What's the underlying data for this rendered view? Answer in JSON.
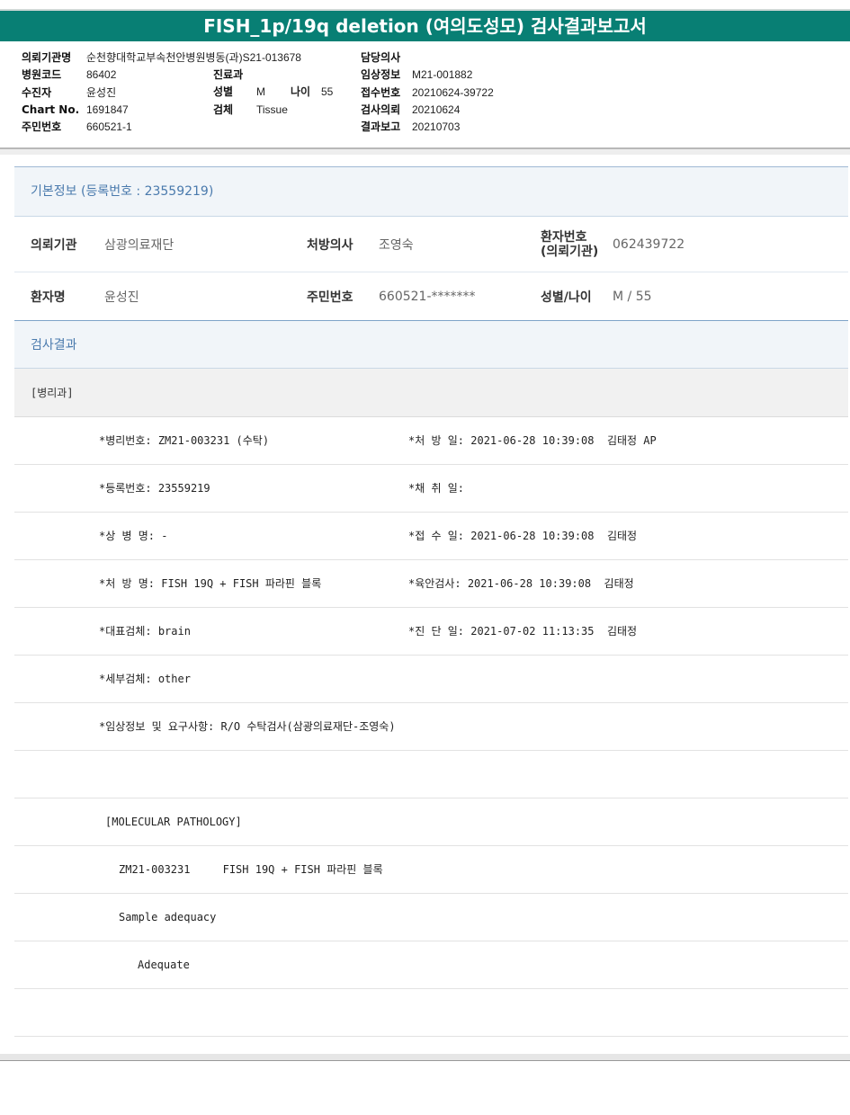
{
  "title": "FISH_1p/19q deletion (여의도성모) 검사결과보고서",
  "header": {
    "col1": [
      {
        "label": "의뢰기관명",
        "value": "순천향대학교부속천안병원병동(과)S21-013678"
      },
      {
        "label": "병원코드",
        "value": "86402"
      },
      {
        "label": "수진자",
        "value": "윤성진"
      },
      {
        "label": "Chart No.",
        "value": "1691847"
      },
      {
        "label": "주민번호",
        "value": "660521-1"
      }
    ],
    "col2": [
      {
        "label": "진료과",
        "value": ""
      },
      {
        "label": "성별",
        "value": "M",
        "age_label": "나이",
        "age_value": "55"
      },
      {
        "label": "검체",
        "value": "Tissue"
      }
    ],
    "col3": [
      {
        "label": "담당의사",
        "value": ""
      },
      {
        "label": "임상정보",
        "value": "M21-001882"
      },
      {
        "label": "접수번호",
        "value": "20210624-39722"
      },
      {
        "label": "검사의뢰",
        "value": "20210624"
      },
      {
        "label": "결과보고",
        "value": "20210703"
      }
    ]
  },
  "basic_info": {
    "heading": "기본정보",
    "reg_label": "(등록번호 : 23559219)",
    "row1": {
      "k1": "의뢰기관",
      "v1": "삼광의료재단",
      "k2": "처방의사",
      "v2": "조영숙",
      "k3_line1": "환자번호",
      "k3_line2": "(의뢰기관)",
      "v3": "062439722"
    },
    "row2": {
      "k1": "환자명",
      "v1": "윤성진",
      "k2": "주민번호",
      "v2": "660521-*******",
      "k3": "성별/나이",
      "v3": "M / 55"
    }
  },
  "results": {
    "heading": "검사결과",
    "dept": "[병리과]",
    "lines": [
      {
        "left": "*병리번호: ZM21-003231 (수탁)",
        "right": "*처 방 일: 2021-06-28 10:39:08  김태정 AP"
      },
      {
        "left": "*등록번호: 23559219",
        "right": "*채 취 일:"
      },
      {
        "left": "*상 병 명: -",
        "right": "*접 수 일: 2021-06-28 10:39:08  김태정"
      },
      {
        "left": "*처 방 명: FISH 19Q + FISH 파라핀 블록",
        "right": "*육안검사: 2021-06-28 10:39:08  김태정"
      },
      {
        "left": "*대표검체: brain",
        "right": "*진 단 일: 2021-07-02 11:13:35  김태정"
      },
      {
        "left": "*세부검체: other",
        "right": ""
      },
      {
        "left": "*임상정보 및 요구사항: R/O 수탁검사(삼광의료재단-조영숙)",
        "right": ""
      }
    ],
    "mol_heading": "[MOLECULAR PATHOLOGY]",
    "mol_line": "ZM21-003231     FISH 19Q + FISH 파라핀 블록",
    "sample_label": "Sample adequacy",
    "sample_value": "Adequate"
  }
}
